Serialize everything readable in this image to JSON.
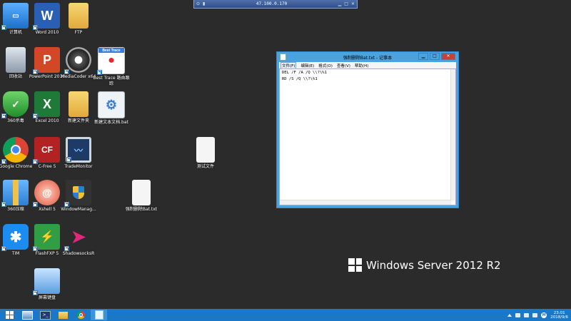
{
  "rdp_bar": {
    "address": "47.100.0.170"
  },
  "desktop_icons": [
    {
      "label": "计算机"
    },
    {
      "label": "Word 2010"
    },
    {
      "label": "FTP"
    },
    {
      "label": "回收站"
    },
    {
      "label": "PowerPoint 2010"
    },
    {
      "label": "MediaCoder x64"
    },
    {
      "label": "Best Trace 路由跟踪"
    },
    {
      "label": "360杀毒"
    },
    {
      "label": "Excel 2010"
    },
    {
      "label": "新建文件夹"
    },
    {
      "label": "新建文本文档.bat"
    },
    {
      "label": "Google Chrome"
    },
    {
      "label": "C-Free 5"
    },
    {
      "label": "TradeMonitor"
    },
    {
      "label": "测试文件"
    },
    {
      "label": "360压缩"
    },
    {
      "label": "Xshell 5"
    },
    {
      "label": "WindowManag..."
    },
    {
      "label": "强制删除Bat.txt"
    },
    {
      "label": "TIM"
    },
    {
      "label": "FlashFXP 5"
    },
    {
      "label": "ShadowsocksR"
    },
    {
      "label": "屏幕键盘"
    }
  ],
  "notepad": {
    "title": "强制删除Bat.txt - 记事本",
    "menu": [
      "文件(F)",
      "编辑(E)",
      "格式(O)",
      "查看(V)",
      "帮助(H)"
    ],
    "content_lines": [
      "DEL /F /A /Q \\\\?\\%1",
      "RD /S /Q \\\\?\\%1"
    ],
    "controls": {
      "minimize": "▁",
      "maximize": "□",
      "close": "✕"
    }
  },
  "branding": {
    "text": "Windows Server 2012 R2"
  },
  "taskbar": {
    "tray_badge": "M",
    "time": "23:01",
    "date": "2018/9/6"
  },
  "colors": {
    "taskbar": "#1b78c6",
    "window_frame": "#4aa3df",
    "desktop": "#2b2b2b"
  }
}
